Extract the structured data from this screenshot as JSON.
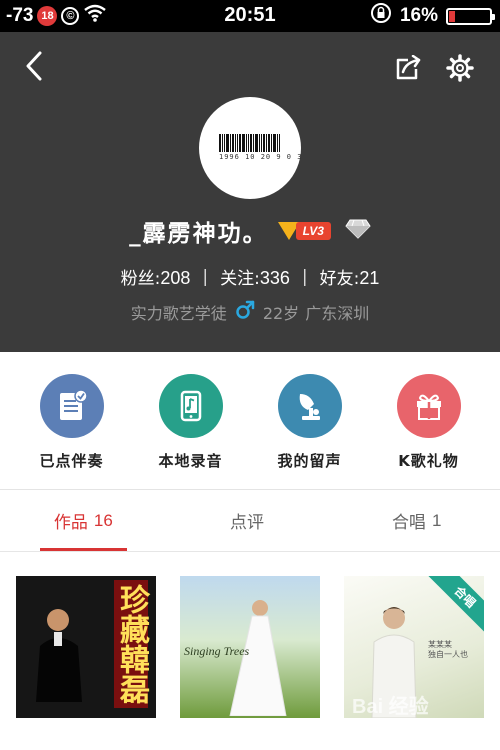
{
  "status_bar": {
    "signal": "-73",
    "age_badge": "18",
    "copyright_mark": "©",
    "time": "20:51",
    "battery": "16%",
    "battery_level": 0.16
  },
  "profile": {
    "avatar_barcode_digits": "1996 10 20  9 0 3",
    "name": "_霹雳神功。",
    "level": "LV3",
    "stats": [
      {
        "label": "粉丝:",
        "value": "208"
      },
      {
        "label": "关注:",
        "value": "336"
      },
      {
        "label": "好友:",
        "value": "21"
      }
    ],
    "stat_separator": "|",
    "title": "实力歌艺学徒",
    "age": "22岁",
    "location": "广东深圳"
  },
  "actions": [
    {
      "label": "已点伴奏",
      "color": "#5c7fb6",
      "icon": "list-check-icon"
    },
    {
      "label": "本地录音",
      "color": "#27a08a",
      "icon": "phone-music-icon"
    },
    {
      "label": "我的留声",
      "color": "#3d8ab0",
      "icon": "gramophone-icon"
    },
    {
      "label": "K歌礼物",
      "color": "#e8646b",
      "icon": "gift-icon"
    }
  ],
  "tabs": [
    {
      "label": "作品",
      "count": "16",
      "active": true
    },
    {
      "label": "点评",
      "count": "",
      "active": false
    },
    {
      "label": "合唱",
      "count": "1",
      "active": false
    }
  ],
  "works": [
    {
      "cover_title": "珍藏韓磊"
    },
    {
      "cover_title": "Singing Trees"
    },
    {
      "cover_title": "",
      "ribbon": "合唱",
      "cover_text": "某某某\n独自一人也"
    }
  ],
  "watermark": "Bai 经验",
  "colors": {
    "accent": "#d83434",
    "header_bg": "#3b3b3b"
  }
}
